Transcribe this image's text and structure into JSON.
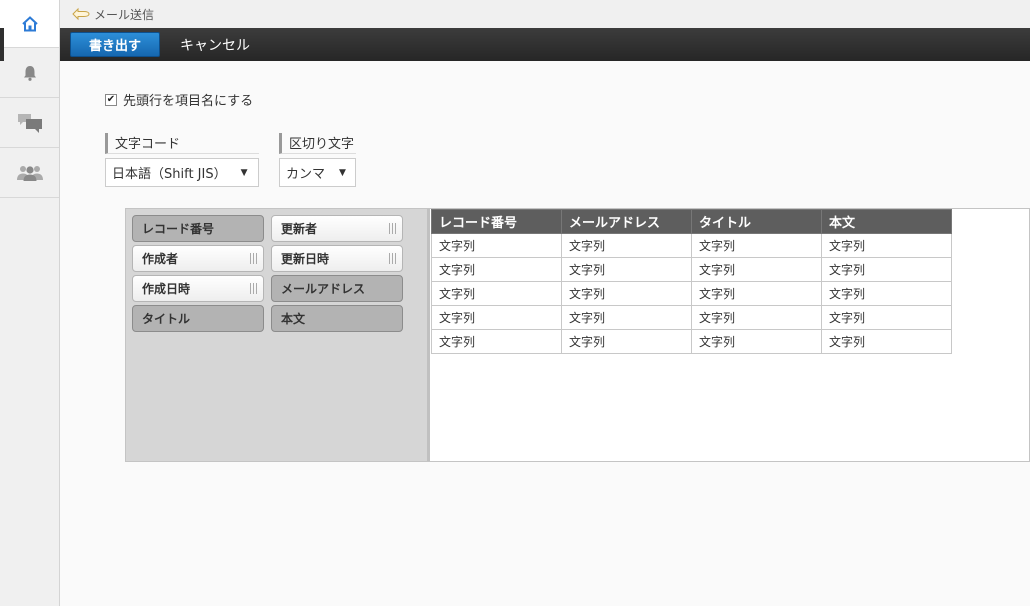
{
  "sidebar": {
    "items": [
      {
        "icon": "home-icon",
        "active": true
      },
      {
        "icon": "bell-icon",
        "active": false
      },
      {
        "icon": "chat-icon",
        "active": false
      },
      {
        "icon": "people-icon",
        "active": false
      }
    ],
    "accent": "#2d7bd6"
  },
  "breadcrumb": {
    "icon": "back-arrow-icon",
    "text": "メール送信"
  },
  "toolbar": {
    "export_label": "書き出す",
    "cancel_label": "キャンセル"
  },
  "options": {
    "header_row_checked": true,
    "header_row_label": "先頭行を項目名にする",
    "encoding_label": "文字コード",
    "encoding_value": "日本語（Shift JIS）",
    "delimiter_label": "区切り文字",
    "delimiter_value": "カンマ"
  },
  "palette": {
    "chips": [
      {
        "label": "レコード番号",
        "used": true
      },
      {
        "label": "更新者",
        "used": false
      },
      {
        "label": "作成者",
        "used": false
      },
      {
        "label": "更新日時",
        "used": false
      },
      {
        "label": "作成日時",
        "used": false
      },
      {
        "label": "メールアドレス",
        "used": true
      },
      {
        "label": "タイトル",
        "used": true
      },
      {
        "label": "本文",
        "used": true
      }
    ]
  },
  "preview": {
    "columns": [
      "レコード番号",
      "メールアドレス",
      "タイトル",
      "本文"
    ],
    "rows": [
      [
        "文字列",
        "文字列",
        "文字列",
        "文字列"
      ],
      [
        "文字列",
        "文字列",
        "文字列",
        "文字列"
      ],
      [
        "文字列",
        "文字列",
        "文字列",
        "文字列"
      ],
      [
        "文字列",
        "文字列",
        "文字列",
        "文字列"
      ],
      [
        "文字列",
        "文字列",
        "文字列",
        "文字列"
      ]
    ]
  }
}
